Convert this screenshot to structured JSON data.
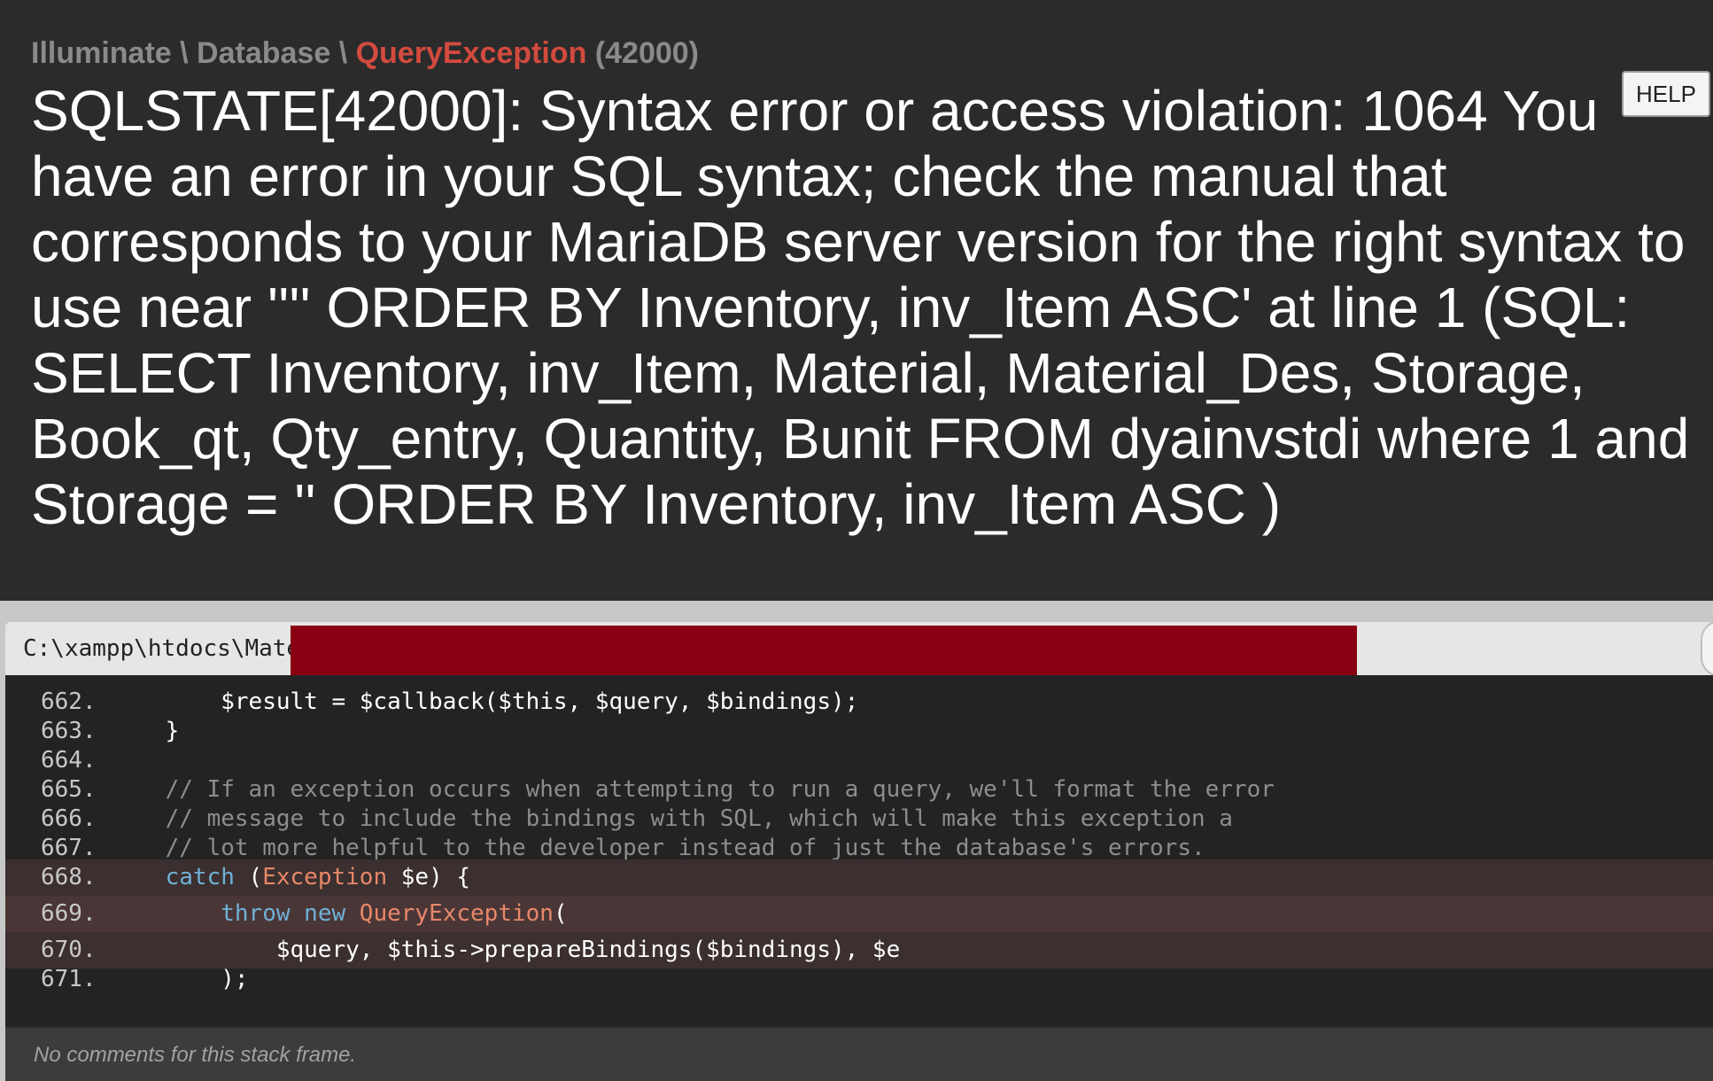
{
  "exception": {
    "namespace_1": "Illuminate",
    "separator": " \\ ",
    "namespace_2": "Database",
    "class_name": "QueryException",
    "code": "(42000)",
    "message": "SQLSTATE[42000]: Syntax error or access violation: 1064 You have an error in your SQL syntax; check the manual that corresponds to your MariaDB server version for the right syntax to use near '''' ORDER BY Inventory, inv_Item ASC' at line 1 (SQL: SELECT Inventory, inv_Item, Material, Material_Des, Storage, Book_qt, Qty_entry, Quantity, Bunit FROM dyainvstdi where 1 and Storage = '' ORDER BY Inventory, inv_Item ASC )"
  },
  "toolbar": {
    "help_label": "HELP"
  },
  "frame": {
    "file_path": "C:\\xampp\\htdocs\\Mate",
    "comments_text": "No comments for this stack frame."
  },
  "code": {
    "lines": [
      {
        "num": "662.",
        "indent": "        ",
        "parts": [
          {
            "t": "$result = $callback($this, $query, $bindings);",
            "k": "plain"
          }
        ]
      },
      {
        "num": "663.",
        "indent": "    ",
        "parts": [
          {
            "t": "}",
            "k": "plain"
          }
        ]
      },
      {
        "num": "664.",
        "indent": "",
        "parts": []
      },
      {
        "num": "665.",
        "indent": "    ",
        "parts": [
          {
            "t": "// If an exception occurs when attempting to run a query, we'll format the error",
            "k": "comment"
          }
        ]
      },
      {
        "num": "666.",
        "indent": "    ",
        "parts": [
          {
            "t": "// message to include the bindings with SQL, which will make this exception a",
            "k": "comment"
          }
        ]
      },
      {
        "num": "667.",
        "indent": "    ",
        "parts": [
          {
            "t": "// lot more helpful to the developer instead of just the database's errors.",
            "k": "comment"
          }
        ]
      },
      {
        "num": "668.",
        "indent": "    ",
        "parts": [
          {
            "t": "catch",
            "k": "keyword"
          },
          {
            "t": " (",
            "k": "plain"
          },
          {
            "t": "Exception",
            "k": "class"
          },
          {
            "t": " $e) {",
            "k": "plain"
          }
        ]
      },
      {
        "num": "669.",
        "indent": "        ",
        "parts": [
          {
            "t": "throw",
            "k": "keyword"
          },
          {
            "t": " ",
            "k": "plain"
          },
          {
            "t": "new",
            "k": "keyword"
          },
          {
            "t": " ",
            "k": "plain"
          },
          {
            "t": "QueryException",
            "k": "class"
          },
          {
            "t": "(",
            "k": "plain"
          }
        ]
      },
      {
        "num": "670.",
        "indent": "            ",
        "parts": [
          {
            "t": "$query, $this->prepareBindings($bindings), $e",
            "k": "plain"
          }
        ]
      },
      {
        "num": "671.",
        "indent": "        ",
        "parts": [
          {
            "t": ");",
            "k": "plain"
          }
        ]
      }
    ]
  }
}
